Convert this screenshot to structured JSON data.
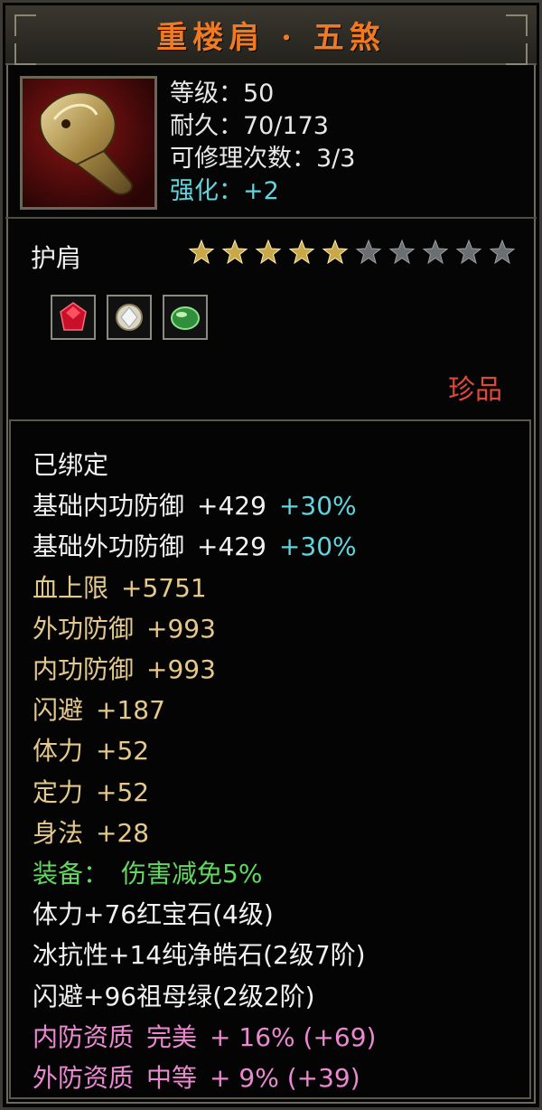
{
  "title": "重楼肩 · 五煞",
  "header": {
    "level": "等级：50",
    "durability": "耐久：70/173",
    "repairs": "可修理次数：3/3",
    "enhance": "强化：+2"
  },
  "item_type": "护肩",
  "stars": {
    "filled": 5,
    "total": 10
  },
  "gems": [
    "ruby-gem-icon",
    "diamond-gem-icon",
    "emerald-gem-icon"
  ],
  "rarity": "珍品",
  "attributes": [
    {
      "name": "已绑定",
      "value": "",
      "extra": "",
      "color": "#f2f2f2"
    },
    {
      "name": "基础内功防御",
      "value": "+429",
      "extra": "+30%",
      "color": "#f2f2f2"
    },
    {
      "name": "基础外功防御",
      "value": "+429",
      "extra": "+30%",
      "color": "#f2f2f2"
    },
    {
      "name": "血上限",
      "value": "+5751",
      "extra": "",
      "color": "#e5c98a"
    },
    {
      "name": "外功防御",
      "value": "+993",
      "extra": "",
      "color": "#e5c98a"
    },
    {
      "name": "内功防御",
      "value": "+993",
      "extra": "",
      "color": "#e5c98a"
    },
    {
      "name": "闪避",
      "value": "+187",
      "extra": "",
      "color": "#e5c98a"
    },
    {
      "name": "体力",
      "value": "+52",
      "extra": "",
      "color": "#e5c98a"
    },
    {
      "name": "定力",
      "value": "+52",
      "extra": "",
      "color": "#e5c98a"
    },
    {
      "name": "身法",
      "value": "+28",
      "extra": "",
      "color": "#e5c98a"
    },
    {
      "name": "装备：",
      "value": "伤害减免5%",
      "extra": "",
      "color": "#62d860"
    },
    {
      "name": "体力+76红宝石(4级)",
      "value": "",
      "extra": "",
      "color": "#f2f2f2"
    },
    {
      "name": "冰抗性+14纯净皓石(2级7阶)",
      "value": "",
      "extra": "",
      "color": "#f2f2f2"
    },
    {
      "name": "闪避+96祖母绿(2级2阶)",
      "value": "",
      "extra": "",
      "color": "#f2f2f2"
    },
    {
      "name": "内防资质",
      "value": "完美",
      "extra": "+ 16% (+69)",
      "color": "#ea88d0"
    },
    {
      "name": "外防资质",
      "value": "中等",
      "extra": "+ 9% (+39)",
      "color": "#ea88d0"
    }
  ],
  "colors": {
    "title": "#f07a22",
    "enhance": "#5fd6dd",
    "rarity": "#e0483a",
    "star_filled": "#c9a84a",
    "star_empty": "#6b6f72"
  }
}
